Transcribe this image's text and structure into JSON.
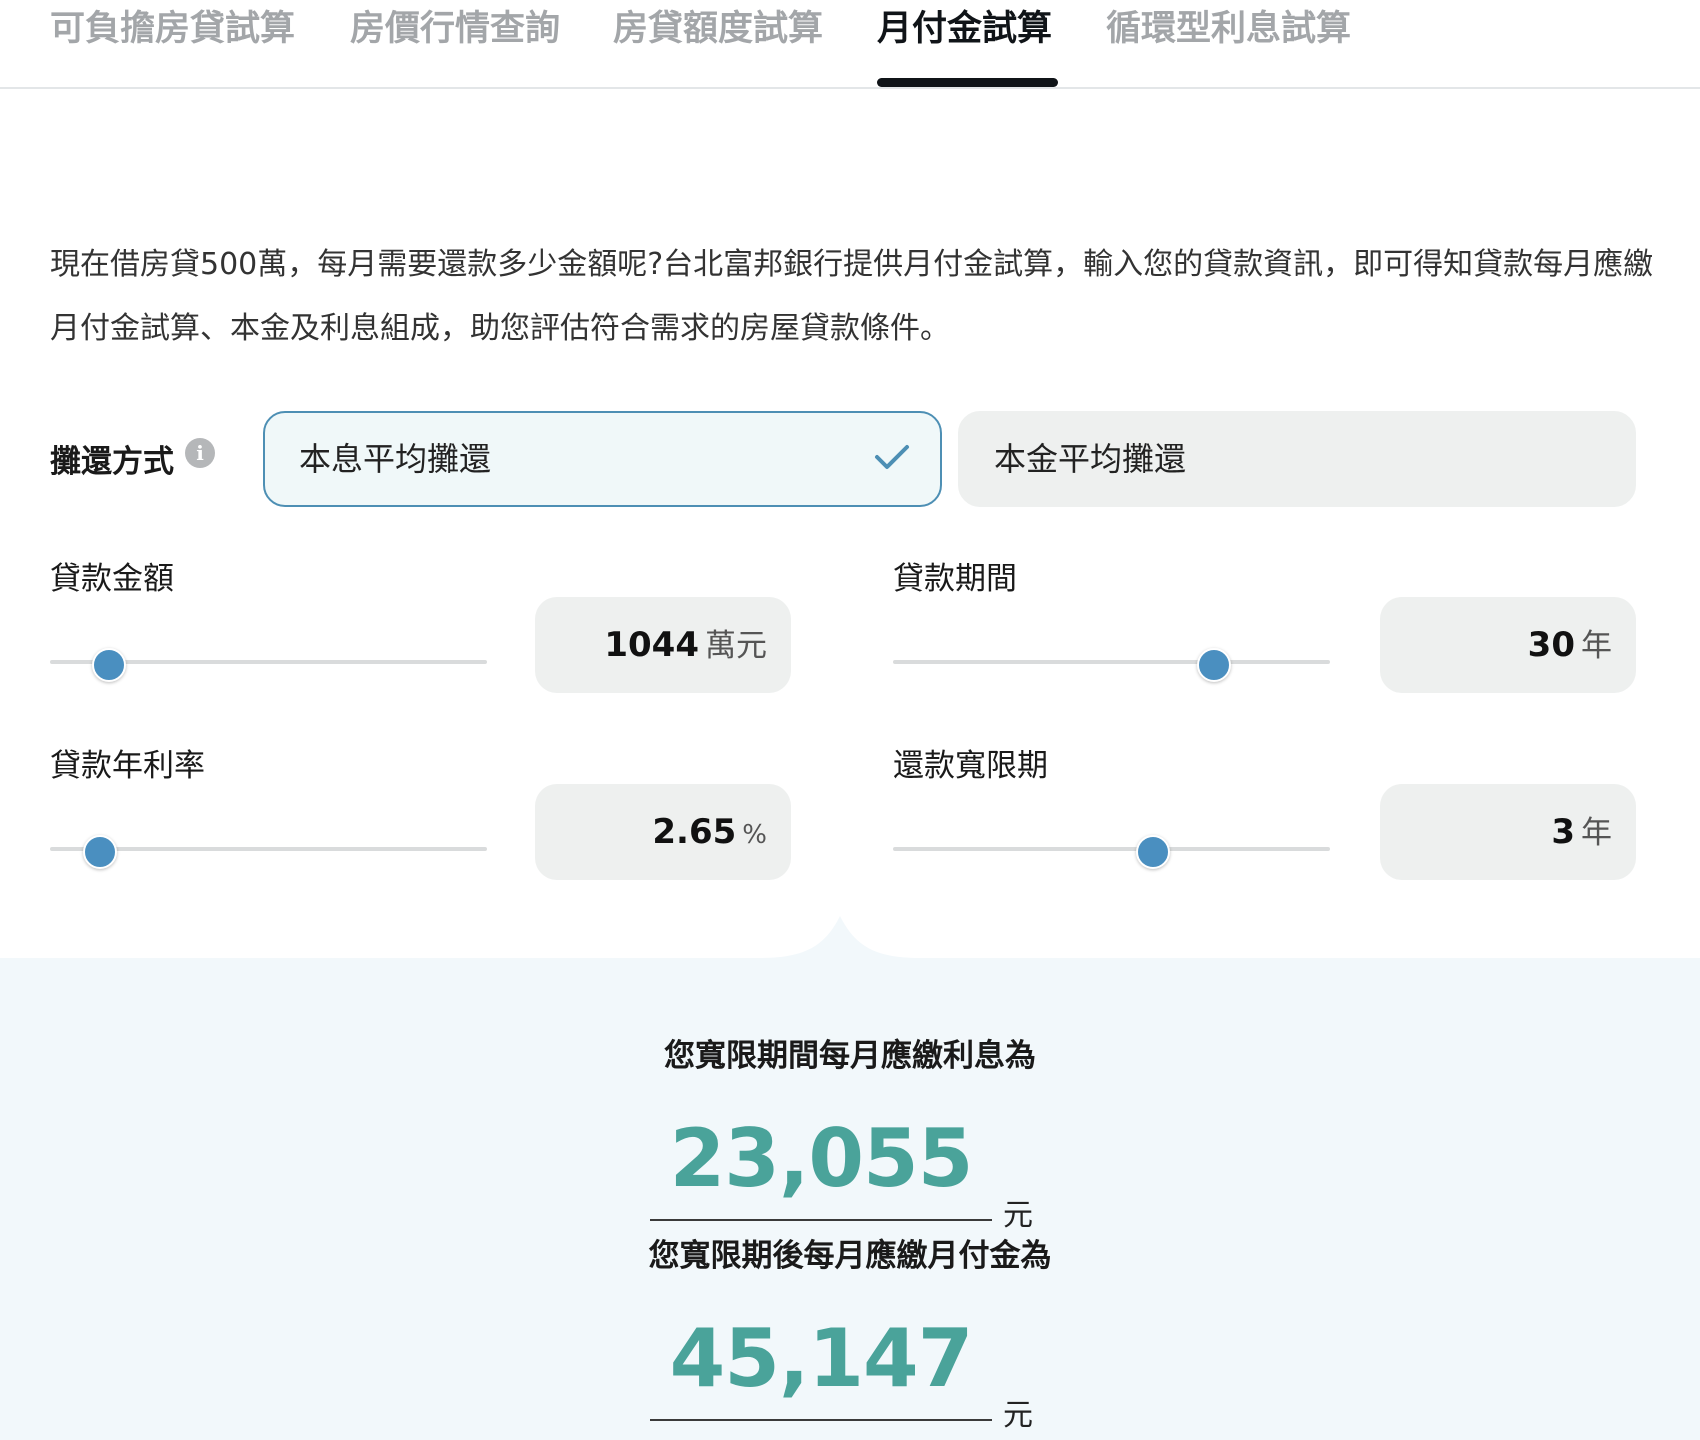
{
  "tabs": [
    {
      "label": "可負擔房貸試算",
      "active": false
    },
    {
      "label": "房價行情查詢",
      "active": false
    },
    {
      "label": "房貸額度試算",
      "active": false
    },
    {
      "label": "月付金試算",
      "active": true
    },
    {
      "label": "循環型利息試算",
      "active": false
    }
  ],
  "intro": "現在借房貸500萬，每月需要還款多少金額呢?台北富邦銀行提供月付金試算，輸入您的貸款資訊，即可得知貸款每月應繳月付金試算、本金及利息組成，助您評估符合需求的房屋貸款條件。",
  "repayment": {
    "label": "攤還方式",
    "info_icon": "info-icon",
    "options": [
      {
        "label": "本息平均攤還",
        "selected": true
      },
      {
        "label": "本金平均攤還",
        "selected": false
      }
    ]
  },
  "fields": {
    "amount": {
      "label": "貸款金額",
      "value": "1044",
      "unit": "萬元",
      "slider_fraction": 0.13
    },
    "period": {
      "label": "貸款期間",
      "value": "30",
      "unit": "年",
      "slider_fraction": 0.73
    },
    "rate": {
      "label": "貸款年利率",
      "value": "2.65",
      "unit": "%",
      "slider_fraction": 0.11
    },
    "grace": {
      "label": "還款寬限期",
      "value": "3",
      "unit": "年",
      "slider_fraction": 0.59
    }
  },
  "results": {
    "grace_title": "您寬限期間每月應繳利息為",
    "grace_value": "23,055",
    "grace_unit": "元",
    "after_title": "您寬限期後每月應繳月付金為",
    "after_value": "45,147",
    "after_unit": "元"
  },
  "colors": {
    "accent": "#4aa39a",
    "slider": "#4a8fc0",
    "selected_border": "#4d8fb4"
  }
}
